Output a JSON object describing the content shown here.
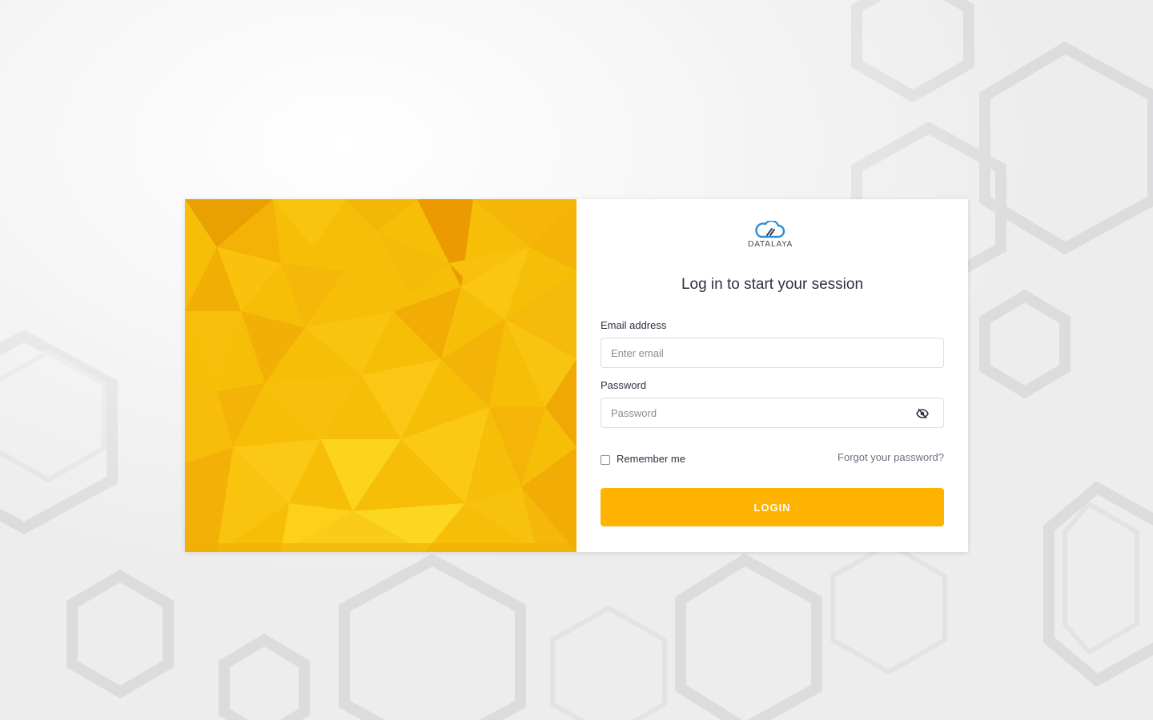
{
  "brand": {
    "name": "DATALAYA",
    "logo_color": "#2a8fd6"
  },
  "login": {
    "title": "Log in to start your session",
    "email_label": "Email address",
    "email_placeholder": "Enter email",
    "email_value": "",
    "password_label": "Password",
    "password_placeholder": "Password",
    "password_value": "",
    "remember_label": "Remember me",
    "remember_checked": false,
    "forgot_label": "Forgot your password?",
    "submit_label": "LOGIN"
  },
  "colors": {
    "accent": "#fdb300",
    "art_yellow": "#f7be08",
    "art_orange": "#ee9a00",
    "text": "#2f3142",
    "muted": "#6e7080"
  },
  "icons": {
    "password_toggle": "eye-slash-icon",
    "logo": "cloud-logo-icon"
  }
}
